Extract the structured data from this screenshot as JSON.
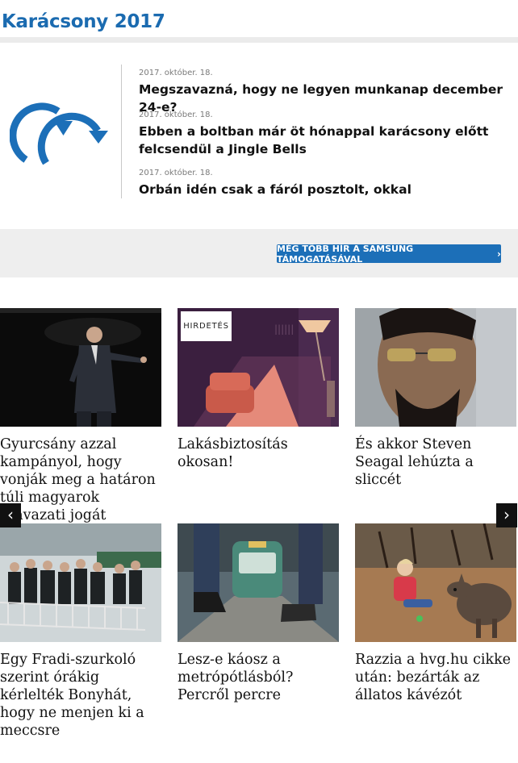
{
  "section": {
    "title": "Karácsony 2017"
  },
  "logo": {
    "icon": "refresh-arrows-icon",
    "color": "#1c6fb8"
  },
  "news": [
    {
      "date": "2017. október. 18.",
      "headline": "Megszavazná, hogy ne legyen munkanap december 24-e?"
    },
    {
      "date": "2017. október. 18.",
      "headline": "Ebben a boltban már öt hónappal karácsony előtt felcsendül a Jingle Bells"
    },
    {
      "date": "2017. október. 18.",
      "headline": "Orbán idén csak a fáról posztolt, okkal"
    }
  ],
  "promo": {
    "button_label": "MÉG TÖBB HÍR A SAMSUNG TÁMOGATÁSÁVAL",
    "chevron": "›",
    "accent": "#1c6fb8"
  },
  "cards": [
    {
      "title": "Gyurcsány azzal kampányol, hogy vonják meg a határon túli magyarok szavazati jogát"
    },
    {
      "title": "Lakásbiztosítás okosan!",
      "badge": "HIRDETÉS"
    },
    {
      "title": "És akkor Steven Seagal lehúzta a sliccét"
    },
    {
      "title": "Egy Fradi-szurkoló szerint órákig kérlelték Bonyhát, hogy ne menjen ki a meccsre"
    },
    {
      "title": "Lesz-e káosz a metrópótlásból? Percről percre"
    },
    {
      "title": "Razzia a hvg.hu cikke után: bezárták az állatos kávézót"
    }
  ],
  "carousel": {
    "prev": "‹",
    "next": "›"
  }
}
